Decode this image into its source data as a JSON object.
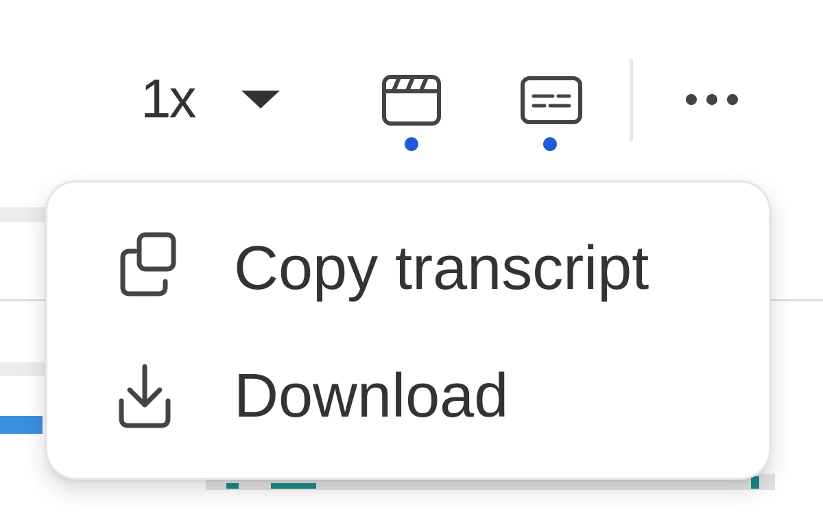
{
  "toolbar": {
    "speed_value": "1x",
    "icons": {
      "speed_dropdown": "caret-down-icon",
      "clip": "clapperboard-icon",
      "captions": "captions-icon",
      "more": "more-horizontal-icon"
    },
    "indicator_color": "#1f5bd7"
  },
  "menu": {
    "items": [
      {
        "label": "Copy transcript",
        "icon": "copy-icon"
      },
      {
        "label": "Download",
        "icon": "download-icon"
      }
    ]
  },
  "colors": {
    "text": "#333333",
    "progress_accent": "#3b8fe0",
    "teal_accent": "#1a8a86"
  }
}
